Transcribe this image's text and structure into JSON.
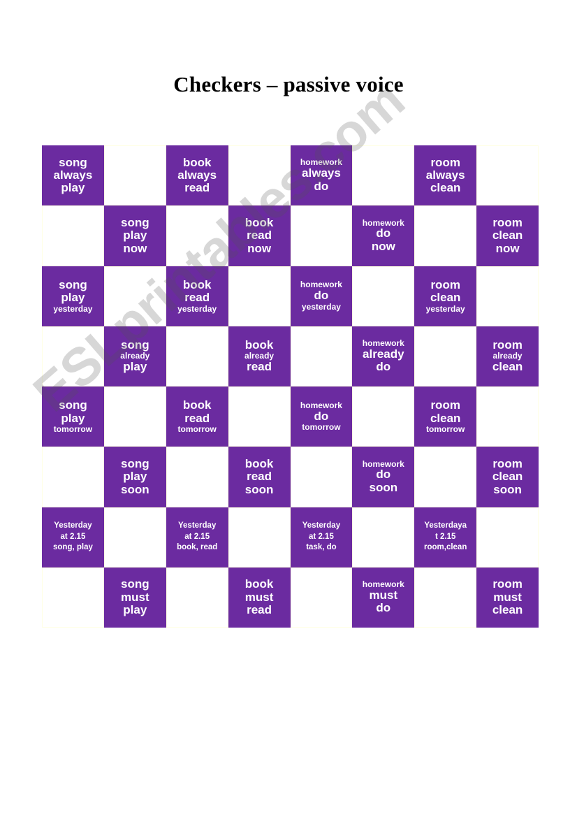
{
  "page": {
    "title": "Checkers – passive voice",
    "background_color": "#FFFFFF"
  },
  "watermark": {
    "text": "ESLprintables.com",
    "color": "#505050"
  },
  "board": {
    "columns": 8,
    "rows": 8,
    "dark_color": "#6B2BA0",
    "light_color": "#FFFFFF",
    "light_border_color": "#FFFFE4",
    "cells": [
      [
        {
          "type": "dark",
          "lines": [
            {
              "text": "song",
              "size": "big"
            },
            {
              "text": "always",
              "size": "big"
            },
            {
              "text": "play",
              "size": "big"
            }
          ]
        },
        {
          "type": "light",
          "lines": []
        },
        {
          "type": "dark",
          "lines": [
            {
              "text": "book",
              "size": "big"
            },
            {
              "text": "always",
              "size": "big"
            },
            {
              "text": "read",
              "size": "big"
            }
          ]
        },
        {
          "type": "light",
          "lines": []
        },
        {
          "type": "dark",
          "lines": [
            {
              "text": "homework",
              "size": "small"
            },
            {
              "text": "always",
              "size": "big"
            },
            {
              "text": "do",
              "size": "big"
            }
          ]
        },
        {
          "type": "light",
          "lines": []
        },
        {
          "type": "dark",
          "lines": [
            {
              "text": "room",
              "size": "big"
            },
            {
              "text": "always",
              "size": "big"
            },
            {
              "text": "clean",
              "size": "big"
            }
          ]
        },
        {
          "type": "light",
          "lines": []
        }
      ],
      [
        {
          "type": "light",
          "lines": []
        },
        {
          "type": "dark",
          "lines": [
            {
              "text": "song",
              "size": "big"
            },
            {
              "text": "play",
              "size": "big"
            },
            {
              "text": "now",
              "size": "big"
            }
          ]
        },
        {
          "type": "light",
          "lines": []
        },
        {
          "type": "dark",
          "lines": [
            {
              "text": "book",
              "size": "big"
            },
            {
              "text": "read",
              "size": "big"
            },
            {
              "text": "now",
              "size": "big"
            }
          ]
        },
        {
          "type": "light",
          "lines": []
        },
        {
          "type": "dark",
          "lines": [
            {
              "text": "homework",
              "size": "small"
            },
            {
              "text": "do",
              "size": "big"
            },
            {
              "text": "now",
              "size": "big"
            }
          ]
        },
        {
          "type": "light",
          "lines": []
        },
        {
          "type": "dark",
          "lines": [
            {
              "text": "room",
              "size": "big"
            },
            {
              "text": "clean",
              "size": "big"
            },
            {
              "text": "now",
              "size": "big"
            }
          ]
        }
      ],
      [
        {
          "type": "dark",
          "lines": [
            {
              "text": "song",
              "size": "big"
            },
            {
              "text": "play",
              "size": "big"
            },
            {
              "text": "yesterday",
              "size": "small"
            }
          ]
        },
        {
          "type": "light",
          "lines": []
        },
        {
          "type": "dark",
          "lines": [
            {
              "text": "book",
              "size": "big"
            },
            {
              "text": "read",
              "size": "big"
            },
            {
              "text": "yesterday",
              "size": "small"
            }
          ]
        },
        {
          "type": "light",
          "lines": []
        },
        {
          "type": "dark",
          "lines": [
            {
              "text": "homework",
              "size": "small"
            },
            {
              "text": "do",
              "size": "big"
            },
            {
              "text": "yesterday",
              "size": "small"
            }
          ]
        },
        {
          "type": "light",
          "lines": []
        },
        {
          "type": "dark",
          "lines": [
            {
              "text": "room",
              "size": "big"
            },
            {
              "text": "clean",
              "size": "big"
            },
            {
              "text": "yesterday",
              "size": "small"
            }
          ]
        },
        {
          "type": "light",
          "lines": []
        }
      ],
      [
        {
          "type": "light",
          "lines": []
        },
        {
          "type": "dark",
          "lines": [
            {
              "text": "song",
              "size": "big"
            },
            {
              "text": "already",
              "size": "small"
            },
            {
              "text": "play",
              "size": "big"
            }
          ]
        },
        {
          "type": "light",
          "lines": []
        },
        {
          "type": "dark",
          "lines": [
            {
              "text": "book",
              "size": "big"
            },
            {
              "text": "already",
              "size": "small"
            },
            {
              "text": "read",
              "size": "big"
            }
          ]
        },
        {
          "type": "light",
          "lines": []
        },
        {
          "type": "dark",
          "lines": [
            {
              "text": "homework",
              "size": "small"
            },
            {
              "text": "already",
              "size": "big"
            },
            {
              "text": "do",
              "size": "big"
            }
          ]
        },
        {
          "type": "light",
          "lines": []
        },
        {
          "type": "dark",
          "lines": [
            {
              "text": "room",
              "size": "big"
            },
            {
              "text": "already",
              "size": "small"
            },
            {
              "text": "clean",
              "size": "big"
            }
          ]
        }
      ],
      [
        {
          "type": "dark",
          "lines": [
            {
              "text": "song",
              "size": "big"
            },
            {
              "text": "play",
              "size": "big"
            },
            {
              "text": "tomorrow",
              "size": "small"
            }
          ]
        },
        {
          "type": "light",
          "lines": []
        },
        {
          "type": "dark",
          "lines": [
            {
              "text": "book",
              "size": "big"
            },
            {
              "text": "read",
              "size": "big"
            },
            {
              "text": "tomorrow",
              "size": "small"
            }
          ]
        },
        {
          "type": "light",
          "lines": []
        },
        {
          "type": "dark",
          "lines": [
            {
              "text": "homework",
              "size": "small"
            },
            {
              "text": "do",
              "size": "big"
            },
            {
              "text": "tomorrow",
              "size": "small"
            }
          ]
        },
        {
          "type": "light",
          "lines": []
        },
        {
          "type": "dark",
          "lines": [
            {
              "text": "room",
              "size": "big"
            },
            {
              "text": "clean",
              "size": "big"
            },
            {
              "text": "tomorrow",
              "size": "small"
            }
          ]
        },
        {
          "type": "light",
          "lines": []
        }
      ],
      [
        {
          "type": "light",
          "lines": []
        },
        {
          "type": "dark",
          "lines": [
            {
              "text": "song",
              "size": "big"
            },
            {
              "text": "play",
              "size": "big"
            },
            {
              "text": "soon",
              "size": "big"
            }
          ]
        },
        {
          "type": "light",
          "lines": []
        },
        {
          "type": "dark",
          "lines": [
            {
              "text": "book",
              "size": "big"
            },
            {
              "text": "read",
              "size": "big"
            },
            {
              "text": "soon",
              "size": "big"
            }
          ]
        },
        {
          "type": "light",
          "lines": []
        },
        {
          "type": "dark",
          "lines": [
            {
              "text": "homework",
              "size": "small"
            },
            {
              "text": "do",
              "size": "big"
            },
            {
              "text": "soon",
              "size": "big"
            }
          ]
        },
        {
          "type": "light",
          "lines": []
        },
        {
          "type": "dark",
          "lines": [
            {
              "text": "room",
              "size": "big"
            },
            {
              "text": "clean",
              "size": "big"
            },
            {
              "text": "soon",
              "size": "big"
            }
          ]
        }
      ],
      [
        {
          "type": "dark",
          "row_style": "r7",
          "lines": [
            {
              "text": "Yesterday",
              "size": "tiny"
            },
            {
              "text": "at 2.15",
              "size": "tiny"
            },
            {
              "text": "song, play",
              "size": "tiny"
            }
          ]
        },
        {
          "type": "light",
          "lines": []
        },
        {
          "type": "dark",
          "row_style": "r7",
          "lines": [
            {
              "text": "Yesterday",
              "size": "tiny"
            },
            {
              "text": "at 2.15",
              "size": "tiny"
            },
            {
              "text": "book, read",
              "size": "tiny"
            }
          ]
        },
        {
          "type": "light",
          "lines": []
        },
        {
          "type": "dark",
          "row_style": "r7",
          "lines": [
            {
              "text": "Yesterday",
              "size": "tiny"
            },
            {
              "text": "at 2.15",
              "size": "tiny"
            },
            {
              "text": "task, do",
              "size": "tiny"
            }
          ]
        },
        {
          "type": "light",
          "lines": []
        },
        {
          "type": "dark",
          "row_style": "r7",
          "lines": [
            {
              "text": "Yesterdaya",
              "size": "tiny"
            },
            {
              "text": "t 2.15",
              "size": "tiny"
            },
            {
              "text": "room,clean",
              "size": "tiny"
            }
          ]
        },
        {
          "type": "light",
          "lines": []
        }
      ],
      [
        {
          "type": "light",
          "lines": []
        },
        {
          "type": "dark",
          "lines": [
            {
              "text": "song",
              "size": "big"
            },
            {
              "text": "must",
              "size": "big"
            },
            {
              "text": "play",
              "size": "big"
            }
          ]
        },
        {
          "type": "light",
          "lines": []
        },
        {
          "type": "dark",
          "lines": [
            {
              "text": "book",
              "size": "big"
            },
            {
              "text": "must",
              "size": "big"
            },
            {
              "text": "read",
              "size": "big"
            }
          ]
        },
        {
          "type": "light",
          "lines": []
        },
        {
          "type": "dark",
          "lines": [
            {
              "text": "homework",
              "size": "small"
            },
            {
              "text": "must",
              "size": "big"
            },
            {
              "text": "do",
              "size": "big"
            }
          ]
        },
        {
          "type": "light",
          "lines": []
        },
        {
          "type": "dark",
          "lines": [
            {
              "text": "room",
              "size": "big"
            },
            {
              "text": "must",
              "size": "big"
            },
            {
              "text": "clean",
              "size": "big"
            }
          ]
        }
      ]
    ]
  }
}
